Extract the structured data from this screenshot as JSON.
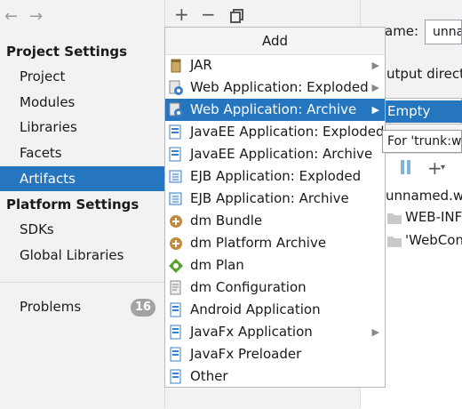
{
  "nav": {
    "back_icon": "arrow-left-icon",
    "forward_icon": "arrow-right-icon"
  },
  "sidebar": {
    "project_settings_heading": "Project Settings",
    "project_items": [
      {
        "label": "Project"
      },
      {
        "label": "Modules"
      },
      {
        "label": "Libraries"
      },
      {
        "label": "Facets"
      },
      {
        "label": "Artifacts",
        "selected": true
      }
    ],
    "platform_settings_heading": "Platform Settings",
    "platform_items": [
      {
        "label": "SDKs"
      },
      {
        "label": "Global Libraries"
      }
    ],
    "problems_label": "Problems",
    "problems_count": "16"
  },
  "toolbar": {
    "add_icon": "plus-icon",
    "remove_icon": "minus-icon",
    "copy_icon": "copy-icon"
  },
  "popup": {
    "title": "Add",
    "items": [
      {
        "label": "JAR",
        "icon": "jar-icon",
        "submenu": true
      },
      {
        "label": "Web Application: Exploded",
        "icon": "web-exploded-icon",
        "submenu": true
      },
      {
        "label": "Web Application: Archive",
        "icon": "web-archive-icon",
        "submenu": true,
        "selected": true
      },
      {
        "label": "JavaEE Application: Exploded",
        "icon": "javaee-exploded-icon",
        "submenu": false
      },
      {
        "label": "JavaEE Application: Archive",
        "icon": "javaee-archive-icon",
        "submenu": false
      },
      {
        "label": "EJB Application: Exploded",
        "icon": "ejb-exploded-icon",
        "submenu": false
      },
      {
        "label": "EJB Application: Archive",
        "icon": "ejb-archive-icon",
        "submenu": false
      },
      {
        "label": "dm Bundle",
        "icon": "dm-bundle-icon",
        "submenu": false
      },
      {
        "label": "dm Platform Archive",
        "icon": "dm-platform-icon",
        "submenu": false
      },
      {
        "label": "dm Plan",
        "icon": "dm-plan-icon",
        "submenu": false
      },
      {
        "label": "dm Configuration",
        "icon": "dm-config-icon",
        "submenu": false
      },
      {
        "label": "Android Application",
        "icon": "android-icon",
        "submenu": false
      },
      {
        "label": "JavaFx Application",
        "icon": "javafx-app-icon",
        "submenu": true
      },
      {
        "label": "JavaFx Preloader",
        "icon": "javafx-preloader-icon",
        "submenu": false
      },
      {
        "label": "Other",
        "icon": "other-icon",
        "submenu": false
      }
    ]
  },
  "submenu": {
    "empty_label": "Empty",
    "tooltip": "For 'trunk:w"
  },
  "right": {
    "name_label": "ame:",
    "name_value": "unna",
    "output_label": "utput directo",
    "tree_root": "unnamed.wa",
    "tree_items": [
      "WEB-INF",
      "'WebCon"
    ]
  },
  "colors": {
    "selection": "#2675bf",
    "badge": "#a3a3a3"
  }
}
